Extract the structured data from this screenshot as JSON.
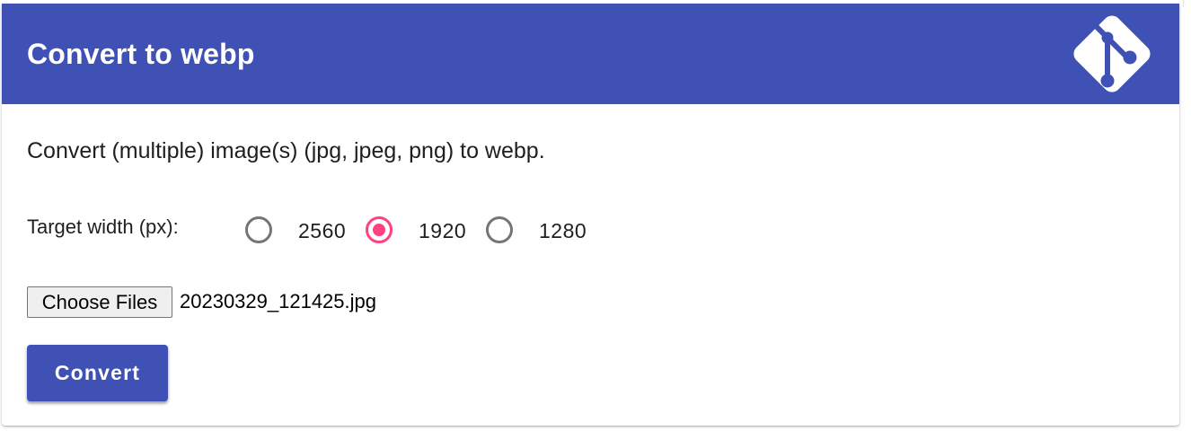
{
  "header": {
    "title": "Convert to webp",
    "background_color": "#3f51b5",
    "logo_icon": "git-logo-icon"
  },
  "main": {
    "description": "Convert (multiple) image(s) (jpg, jpeg, png) to webp.",
    "target_width": {
      "label": "Target width (px):",
      "options": [
        {
          "label": "2560",
          "checked": false
        },
        {
          "label": "1920",
          "checked": true
        },
        {
          "label": "1280",
          "checked": false
        }
      ],
      "accent_color": "#ff4081"
    },
    "file_input": {
      "button_label": "Choose Files",
      "file_name": "20230329_121425.jpg"
    },
    "convert_button": {
      "label": "Convert",
      "color": "#3f51b5"
    }
  }
}
